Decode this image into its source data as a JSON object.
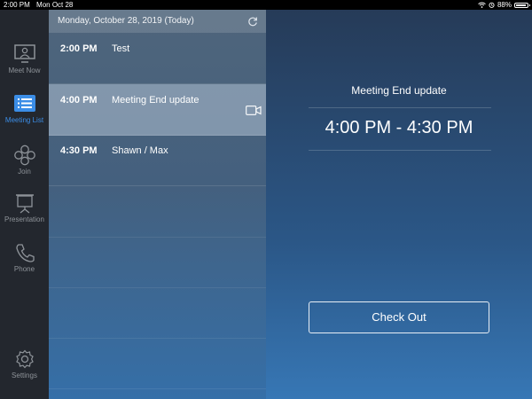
{
  "status_bar": {
    "time": "2:00 PM",
    "date": "Mon Oct 28",
    "battery_text": "88%",
    "battery_level": 0.88
  },
  "sidebar": {
    "items": [
      {
        "label": "Meet Now",
        "icon": "monitor-icon",
        "active": false
      },
      {
        "label": "Meeting List",
        "icon": "list-icon",
        "active": true
      },
      {
        "label": "Join",
        "icon": "join-icon",
        "active": false
      },
      {
        "label": "Presentation",
        "icon": "presentation-icon",
        "active": false
      },
      {
        "label": "Phone",
        "icon": "phone-icon",
        "active": false
      },
      {
        "label": "Settings",
        "icon": "gear-icon",
        "active": false
      }
    ]
  },
  "meeting_list": {
    "header_date": "Monday, October 28, 2019 (Today)",
    "rows": [
      {
        "time": "2:00 PM",
        "title": "Test",
        "video": false,
        "selected": false
      },
      {
        "time": "4:00 PM",
        "title": "Meeting End update",
        "video": true,
        "selected": true
      },
      {
        "time": "4:30 PM",
        "title": "Shawn / Max",
        "video": false,
        "selected": false
      }
    ]
  },
  "detail": {
    "title": "Meeting End update",
    "time_range": "4:00 PM - 4:30 PM",
    "checkout_label": "Check Out"
  },
  "colors": {
    "accent": "#3b8de6",
    "sidebar_bg": "#23272e",
    "detail_bg_top": "#263b58"
  }
}
